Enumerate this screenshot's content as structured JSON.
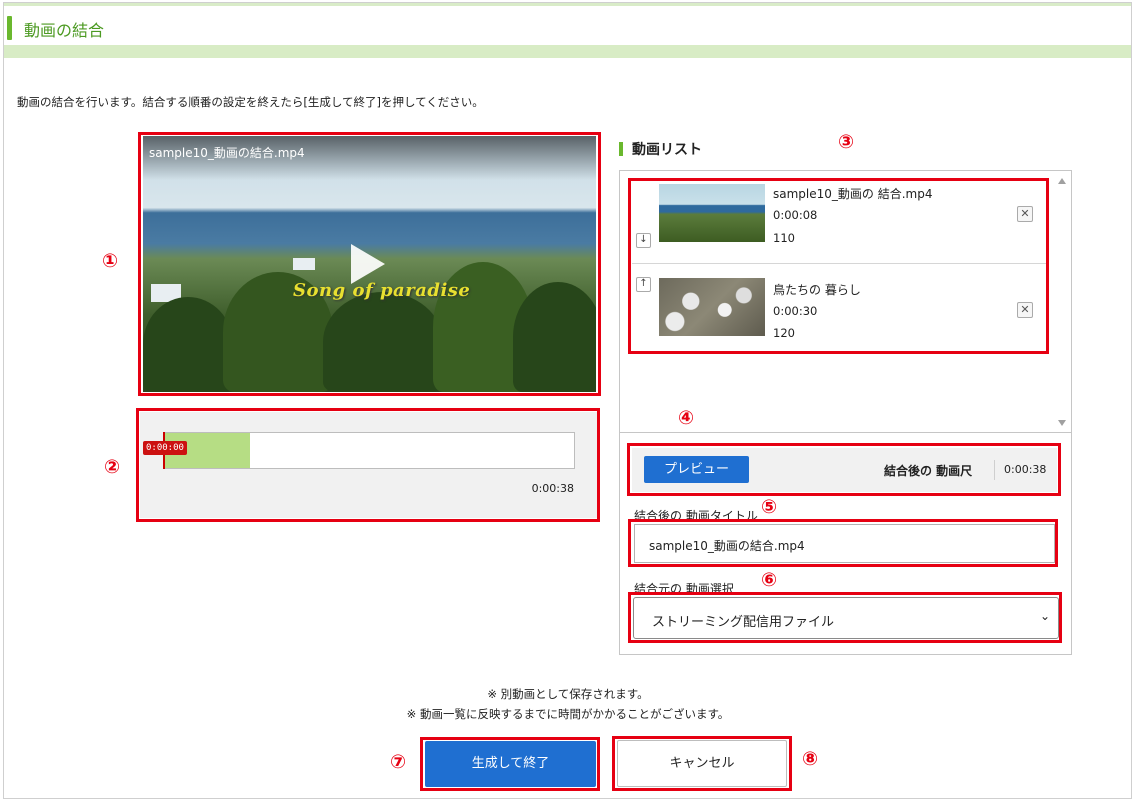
{
  "header": {
    "title": "動画の結合"
  },
  "instruction": "動画の結合を行います。結合する順番の設定を終えたら[生成して終了]を押してください。",
  "callouts": [
    "①",
    "②",
    "③",
    "④",
    "⑤",
    "⑥",
    "⑦",
    "⑧"
  ],
  "player": {
    "video_title": "sample10_動画の結合.mp4",
    "overlay_text": "Song of paradise",
    "play_icon": "play-icon"
  },
  "timeline": {
    "current_time": "0:00:00",
    "total_time": "0:00:38",
    "progress": 0.21
  },
  "video_list": {
    "heading": "動画リスト",
    "items": [
      {
        "name": "sample10_動画の 結合.mp4",
        "duration": "0:00:08",
        "size": "110",
        "move_icon": "arrow-down-icon",
        "delete_icon": "close-icon"
      },
      {
        "name": "鳥たちの 暮らし",
        "duration": "0:00:30",
        "size": "120",
        "move_icon": "arrow-up-icon",
        "delete_icon": "close-icon"
      }
    ]
  },
  "preview": {
    "button_label": "プレビュー",
    "duration_label": "結合後の 動画尺",
    "duration_value": "0:00:38"
  },
  "title_field": {
    "label": "結合後の 動画タイトル",
    "value": "sample10_動画の結合.mp4"
  },
  "source_select": {
    "label": "結合元の 動画選択",
    "selected": "ストリーミング配信用ファイル"
  },
  "notes": [
    "※ 別動画として保存されます。",
    "※ 動画一覧に反映するまでに時間がかかることがございます。"
  ],
  "actions": {
    "primary": "生成して終了",
    "secondary": "キャンセル"
  },
  "colors": {
    "accent_green": "#6ab82e",
    "primary_blue": "#1f6fd1",
    "callout_red": "#e60012",
    "timeline_fill": "#b6dd84"
  }
}
